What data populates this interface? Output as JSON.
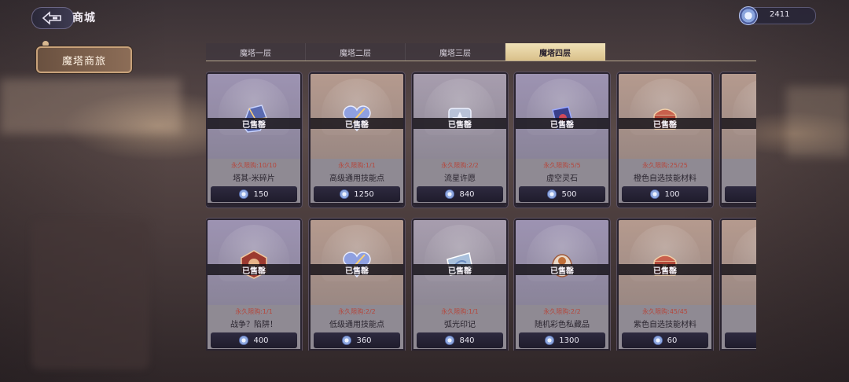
{
  "header": {
    "title": "商城",
    "back_icon": "back-arrow-icon"
  },
  "currency": {
    "amount": "2411",
    "icon": "gem-coin-icon"
  },
  "shop_tag": {
    "label": "魔塔商旅"
  },
  "tabs": [
    {
      "label": "魔塔一层",
      "active": false
    },
    {
      "label": "魔塔二层",
      "active": false
    },
    {
      "label": "魔塔三层",
      "active": false
    },
    {
      "label": "魔塔四层",
      "active": true
    }
  ],
  "sold_label": "已售罄",
  "items": [
    {
      "name": "塔其-米碎片",
      "limit": "永久限购:10/10",
      "price": "150",
      "icon": "fragment-icon",
      "tint": "purple"
    },
    {
      "name": "高级通用技能点",
      "limit": "永久限购:1/1",
      "price": "1250",
      "icon": "heart-crystal-icon",
      "tint": "orange"
    },
    {
      "name": "流星许愿",
      "limit": "永久限购:2/2",
      "price": "840",
      "icon": "star-ticket-icon",
      "tint": "plain"
    },
    {
      "name": "虚空灵石",
      "limit": "永久限购:5/5",
      "price": "500",
      "icon": "void-stone-icon",
      "tint": "purple"
    },
    {
      "name": "橙色自选技能材料",
      "limit": "永久限购:25/25",
      "price": "100",
      "icon": "treasure-chest-icon",
      "tint": "orange"
    },
    {
      "name": "彩色自",
      "limit": "永",
      "price": "",
      "icon": "treasure-chest-icon",
      "tint": "orange"
    },
    {
      "name": "战争？陷阱！",
      "limit": "永久限购:1/1",
      "price": "400",
      "icon": "hexagon-card-icon",
      "tint": "purple"
    },
    {
      "name": "低级通用技能点",
      "limit": "永久限购:2/2",
      "price": "360",
      "icon": "heart-crystal-icon",
      "tint": "orange"
    },
    {
      "name": "弧光印记",
      "limit": "永久限购:1/1",
      "price": "840",
      "icon": "arc-seal-icon",
      "tint": "plain"
    },
    {
      "name": "随机彩色私藏品",
      "limit": "永久限购:2/2",
      "price": "1300",
      "icon": "collectible-icon",
      "tint": "purple"
    },
    {
      "name": "紫色自选技能材料",
      "limit": "永久限购:45/45",
      "price": "60",
      "icon": "treasure-chest-icon",
      "tint": "orange"
    },
    {
      "name": "橙色自",
      "limit": "永",
      "price": "",
      "icon": "treasure-chest-icon",
      "tint": "orange"
    }
  ]
}
